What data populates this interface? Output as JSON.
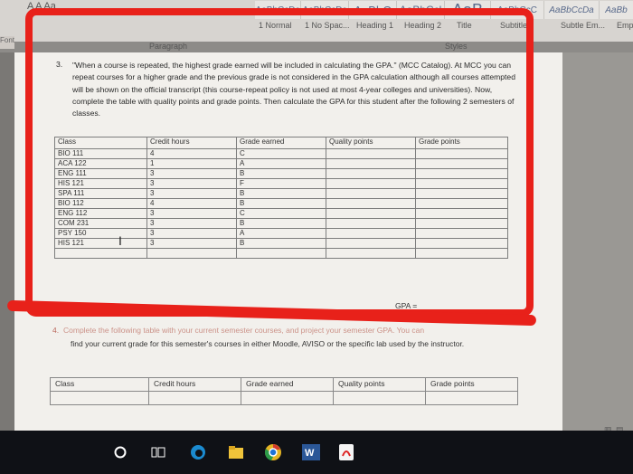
{
  "ribbon": {
    "font_controls": "A  A   Aa",
    "styles": [
      {
        "sample": "AaBbCcDc",
        "label": "1 Normal"
      },
      {
        "sample": "AaBbCcDc",
        "label": "1 No Spac..."
      },
      {
        "sample": "AaBbC",
        "label": "Heading 1"
      },
      {
        "sample": "AaBbCcl",
        "label": "Heading 2"
      },
      {
        "sample": "AaB",
        "label": "Title"
      },
      {
        "sample": "AaBbCcC",
        "label": "Subtitle"
      },
      {
        "sample": "AaBbCcDa",
        "label": "Subtle Em..."
      },
      {
        "sample": "AaBb",
        "label": "Emp"
      }
    ],
    "group_paragraph": "Paragraph",
    "group_styles": "Styles",
    "font_group": "Font"
  },
  "doc": {
    "q3_number": "3.",
    "q3_text": "\"When a course is repeated, the highest grade earned will be included in calculating the GPA.\" (MCC Catalog). At MCC you can repeat courses for a higher grade and the previous grade is not considered in the GPA calculation although all courses attempted will be shown on the official transcript (this course-repeat policy is not used at most 4-year colleges and universities). Now, complete the table with quality points and grade points. Then calculate the GPA for this student after the following 2 semesters of classes.",
    "table_headers": [
      "Class",
      "Credit hours",
      "Grade earned",
      "Quality points",
      "Grade points"
    ],
    "rows": [
      {
        "class": "BIO 111",
        "credit": "4",
        "grade": "C"
      },
      {
        "class": "ACA 122",
        "credit": "1",
        "grade": "A"
      },
      {
        "class": "ENG 111",
        "credit": "3",
        "grade": "B"
      },
      {
        "class": "HIS 121",
        "credit": "3",
        "grade": "F"
      },
      {
        "class": "SPA 111",
        "credit": "3",
        "grade": "B"
      },
      {
        "class": "BIO 112",
        "credit": "4",
        "grade": "B"
      },
      {
        "class": "ENG 112",
        "credit": "3",
        "grade": "C"
      },
      {
        "class": "COM 231",
        "credit": "3",
        "grade": "B"
      },
      {
        "class": "PSY 150",
        "credit": "3",
        "grade": "A"
      },
      {
        "class": "HIS 121",
        "credit": "3",
        "grade": "B"
      }
    ],
    "gpa_label": "GPA =",
    "q4_number": "4.",
    "q4_line1": "Complete the following table with your current semester courses, and project your semester GPA. You can",
    "q4_text": "find your current grade for this semester's courses in either Moodle, AVISO or the specific lab used by the instructor.",
    "table2_headers": [
      "Class",
      "Credit hours",
      "Grade earned",
      "Quality points",
      "Grade points"
    ]
  },
  "taskbar": {
    "icons": [
      "start-icon",
      "task-view-icon",
      "edge-icon",
      "file-explorer-icon",
      "chrome-icon",
      "word-icon",
      "acrobat-icon"
    ]
  },
  "colors": {
    "annotation_red": "#e8211a",
    "taskbar": "#0f1116",
    "page": "#f2f0ec"
  }
}
